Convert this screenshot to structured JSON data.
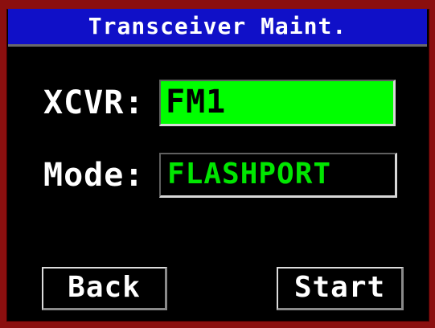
{
  "screen": {
    "title": "Transceiver Maint."
  },
  "form": {
    "xcvr_label": "XCVR:",
    "xcvr_value": "FM1",
    "mode_label": "Mode:",
    "mode_value": "FLASHPORT"
  },
  "buttons": {
    "back_label": "Back",
    "start_label": "Start"
  },
  "colors": {
    "frame": "#8b0f0f",
    "title_bar": "#1010c8",
    "selected_field": "#00ff00",
    "value_text": "#00e600",
    "background": "#000000"
  }
}
